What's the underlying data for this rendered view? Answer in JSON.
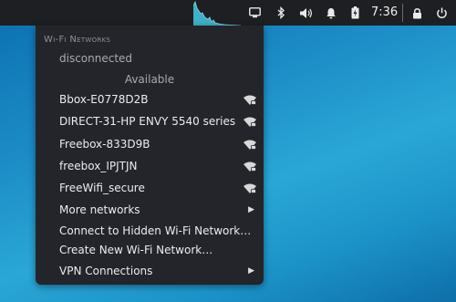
{
  "panel": {
    "clock": "7:36",
    "icons": [
      "display-icon",
      "bluetooth-icon",
      "volume-icon",
      "notification-bell-icon",
      "battery-charging-icon",
      "lock-icon",
      "power-icon"
    ]
  },
  "menu": {
    "section_title": "Wi-Fi Networks",
    "status": "disconnected",
    "available_label": "Available",
    "networks": [
      {
        "ssid": "Bbox-E0778D2B",
        "secured": true
      },
      {
        "ssid": "DIRECT-31-HP ENVY 5540 series",
        "secured": true
      },
      {
        "ssid": "Freebox-833D9B",
        "secured": true
      },
      {
        "ssid": "freebox_IPJTJN",
        "secured": true
      },
      {
        "ssid": "FreeWifi_secure",
        "secured": true
      }
    ],
    "more_networks": "More networks",
    "connect_hidden": "Connect to Hidden Wi-Fi Network…",
    "create_new": "Create New Wi-Fi Network…",
    "vpn": "VPN Connections"
  }
}
